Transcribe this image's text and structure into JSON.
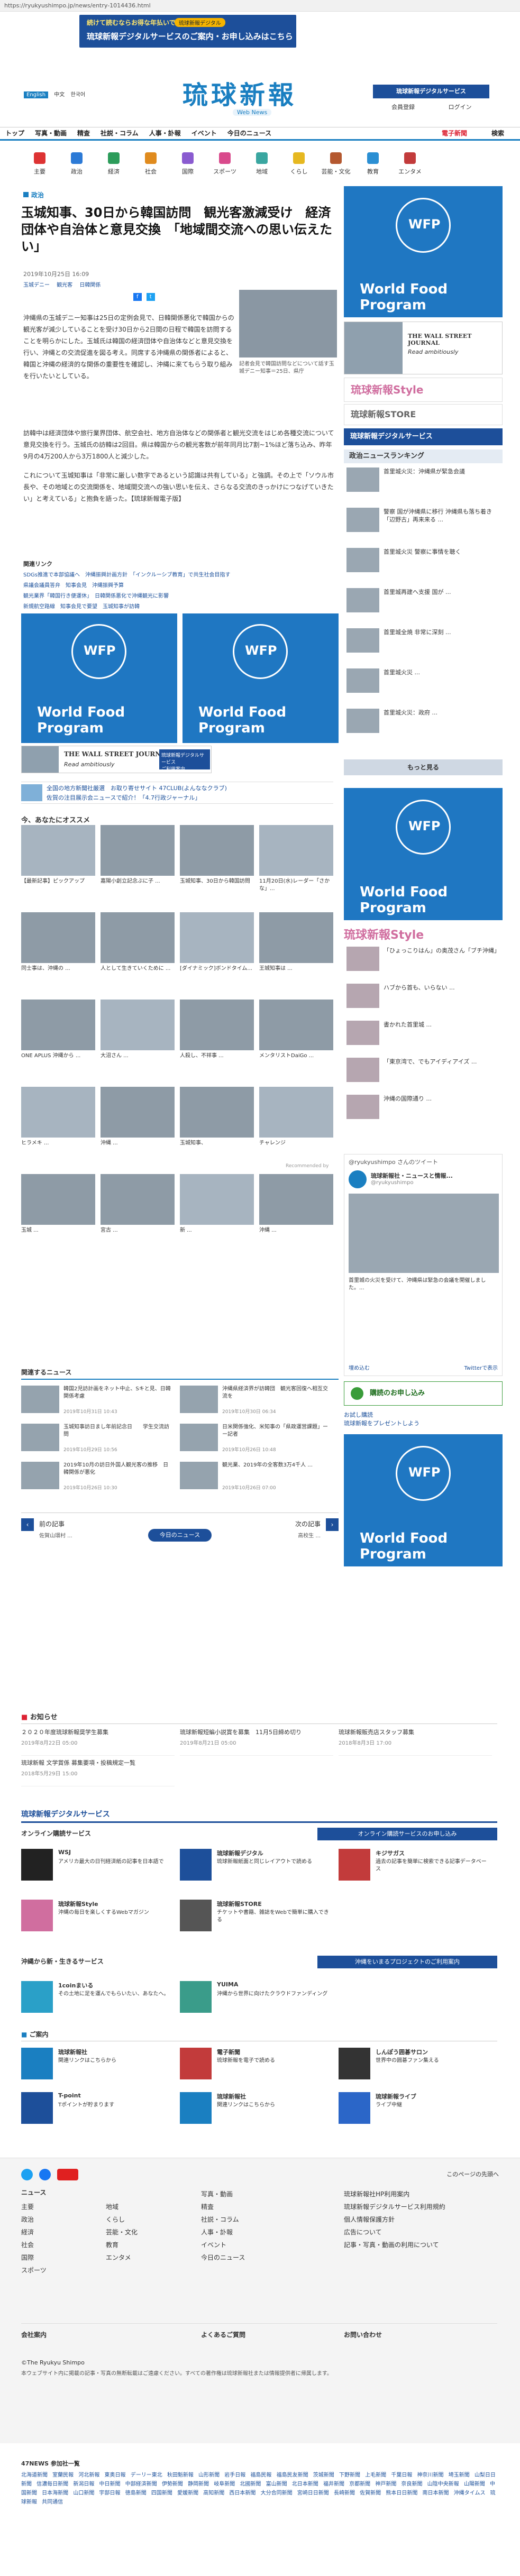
{
  "browser": {
    "url": "https://ryukyushimpo.jp/news/entry-1014436.html"
  },
  "top_banner": {
    "line1": "続けて読むならお得な年払いで",
    "pill": "琉球新報デジタル",
    "line2": "琉球新報デジタルサービスのご案内・お申し込みはこちら"
  },
  "header": {
    "logo": "琉球新報",
    "logo_sub": "Web News",
    "lang": [
      "English",
      "中文",
      "한국어"
    ],
    "digital_btn": "琉球新報デジタルサービス",
    "register": "会員登録",
    "login": "ログイン",
    "subscribe": "購読申込み"
  },
  "nav": [
    "トップ",
    "写真・動画",
    "精査",
    "社説・コラム",
    "人事・訃報",
    "イベント",
    "今日のニュース"
  ],
  "nav_right": {
    "shop": "電子新聞",
    "search": "検索"
  },
  "categories": [
    "主要",
    "政治",
    "経済",
    "社会",
    "国際",
    "スポーツ",
    "地域",
    "くらし",
    "芸能・文化",
    "教育",
    "エンタメ"
  ],
  "article": {
    "section": "政治",
    "title": "玉城知事、30日から韓国訪問　観光客激減受け　経済団体や自治体と意見交換　「地域間交流への思い伝えたい」",
    "meta": "2019年10月25日 16:09",
    "tags": [
      "玉城デニー",
      "観光客",
      "日韓関係"
    ],
    "caption": "記者会見で韓国訪問などについて話す玉城デニー知事＝25日、県庁",
    "p1": "沖縄県の玉城デニー知事は25日の定例会見で、日韓関係悪化で韓国からの観光客が減少していることを受け30日から2日間の日程で韓国を訪問することを明らかにした。玉城氏は韓国の経済団体や自治体などと意見交換を行い、沖縄との交流促進を図る考え。同席する沖縄県の関係者によると、韓国と沖縄の経済的な関係の重要性を確認し、沖縄に来てもらう取り組みを行いたいとしている。",
    "p2": "訪韓中は経済団体や旅行業界団体、航空会社、地方自治体などの関係者と観光交流をはじめ各種交流について意見交換を行う。玉城氏の訪韓は2回目。県は韓国からの観光客数が前年同月比7割~1%ほど落ち込み、昨年9月の4万200人から3万1800人と減少した。",
    "p3": "これについて玉城知事は「非常に厳しい数字であるという認識は共有している」と強調。その上で「ソウル市長や、その地域との交流関係を、地域間交流への強い思いを伝え、さらなる交流のきっかけにつなげていきたい」と考えている」と抱負を語った。【琉球新報電子版】"
  },
  "related_links_title": "関連リンク",
  "related_links": [
    "SDGs推進で本部協議へ　沖縄振興計画方針",
    "「インクルーシブ教育」で共生社会目指す",
    "県議会議員答弁",
    "知事会見",
    "沖縄振興予算",
    "観光業界「韓国行き便運休」",
    "日韓関係悪化で沖縄観光に影響",
    "新規航空路線",
    "知事会見で要望",
    "玉城知事が訪韓"
  ],
  "ads": {
    "wfp_name": "World Food Program",
    "wfp_short": "WFP",
    "wsj_line1": "THE WALL STREET JOURNAL",
    "wsj_line2": "Read ambitiously",
    "wsj_tag": "琉球新報デジタルサービス",
    "wsj_tag2": "ご利用案内"
  },
  "promo_link": "全国の地方新聞社厳選　お取り寄せサイト 47CLUB(よんななクラブ)",
  "promo_link2": "佐賀の注目展示会ニュースで紹介！「4.7行政ジャーナル」",
  "recommend_title": "今、あなたにオススメ",
  "recommend_items": [
    "【最新記事】ピックアップ",
    "嘉陽小創立記念ぶに子 ...",
    "玉城知事、30日から韓国訪問",
    "11月20日(水)レーダー「さかな」...",
    "同士事は、沖縄の ...",
    "人として生きていくために ...",
    "[ダイナミック]ボンドタイム...",
    "王城知事は ...",
    "ONE APLUS 沖縄から ...",
    "大沼さん ...",
    "人殺し、不祥事 ...",
    "メンタリストDaiGo ...",
    "ヒラメキ ...",
    "沖縄 ...",
    "玉城知事、",
    "チャレンジ",
    "玉城 ...",
    "宮古 ...",
    "新 ...",
    "沖縄 ..."
  ],
  "recommended_by": "Recommended by",
  "related_news_title": "関連するニュース",
  "related_news": [
    {
      "t": "韓国2児訪計画をネット中止、Sキと見、日韓関係考慮",
      "d": "2019年10月31日 10:43"
    },
    {
      "t": "沖縄県経済界が訪韓団　観光客回復へ相互交流を",
      "d": "2019年10月30日 06:34"
    },
    {
      "t": "玉城知事訪日まし年前記念日　　学生交流訪問",
      "d": "2019年10月29日 10:56"
    },
    {
      "t": "日米関係強化、米知事の「県政運営課題」ーー記者",
      "d": "2019年10月26日 10:48"
    },
    {
      "t": "2019年10月の訪日外国人観光客の推移　日韓関係が悪化",
      "d": "2019年10月26日 10:30"
    },
    {
      "t": "観光業、2019年の全客数3万4千人 ...",
      "d": "2019年10月26日 07:00"
    }
  ],
  "pager": {
    "prev": "前の記事",
    "next": "次の記事",
    "today": "今日のニュース",
    "prev_title": "佐賀山環村 ...",
    "next_title": "高校生 ..."
  },
  "right": {
    "wsj_tag": "琉球新報Style",
    "store": "琉球新報STORE",
    "digital_head": "琉球新報デジタルサービス",
    "ranking_title": "政治ニュースランキング",
    "ranking": [
      "首里城火災：沖縄県が緊急会議",
      "警察 国が沖縄県に移行 沖縄県も落ち着き 「辺野古」再来来る ...",
      "首里城火災 警察に事情を聴く",
      "首里城再建へ支援 国が ...",
      "首里城全焼 非常に深刻 ...",
      "首里城火災 ...",
      "首里城火災：政府 ..."
    ],
    "more": "もっと見る",
    "style_title": "琉球新報Style",
    "style_items": [
      "「ひょっこりはん」の奥茂さん「ブチ沖縄」",
      "ハブから首も、いらない ...",
      "書かれた首里城 ...",
      "「東京湾で、でもアイディアイズ ...",
      "沖縄の国際通り ..."
    ],
    "twitter_head": "@ryukyushimpo さんのツイート",
    "twitter_name": "琉球新報社・ニュースと情報...",
    "twitter_user": "@ryukyushimpo",
    "twitter_text": "首里城の火災を受けて、沖縄県は緊急の会議を開催しました。...",
    "twitter_embed": "埋め込む",
    "twitter_view": "Twitterで表示",
    "subscribe_box": "購読のお申し込み",
    "present_text": "お試し購読",
    "present_text2": "琉球新報をプレゼントしよう"
  },
  "notices_title": "お知らせ",
  "notices": [
    {
      "t": "２０２０年度琉球新報奨学生募集",
      "d": "2019年8月22日 05:00"
    },
    {
      "t": "琉球新報短編小説賞を募集　11月5日締め切り",
      "d": "2019年8月21日 05:00"
    },
    {
      "t": "琉球新報販売店スタッフ募集",
      "d": "2018年8月3日 17:00"
    },
    {
      "t": "琉球新報 文学賞係 募集要項・投稿規定一覧",
      "d": "2018年5月29日 15:00"
    }
  ],
  "digital": {
    "title": "琉球新報デジタルサービス",
    "online": "オンライン購読サービス",
    "online_btn": "オンライン購読サービスのお申し込み",
    "items": [
      {
        "n": "WSJ",
        "d": "アメリカ最大の日刊経済紙の記事を日本語で"
      },
      {
        "n": "琉球新報デジタル",
        "d": "琉球新報紙面と同じレイアウトで読める"
      },
      {
        "n": "キジサガス",
        "d": "過去の記事を簡単に検索できる記事データベース"
      },
      {
        "n": "琉球新報Style",
        "d": "沖縄の毎日を楽しくするWebマガジン"
      },
      {
        "n": "琉球新報STORE",
        "d": "チケットや書籍、雑誌をWebで簡単に購入できる"
      }
    ],
    "okinawa": "沖縄から新・生きるサービス",
    "okinawa_btn": "沖縄をいまるプロジェクトのご利用案内",
    "ok_items": [
      {
        "n": "1coinまいる",
        "d": "その土地に足を運んでもらいたい、あなたへ。"
      },
      {
        "n": "YUIMA",
        "d": "沖縄から世界に向けたクラウドファンディング"
      }
    ],
    "apps": "ご案内",
    "app_items": [
      {
        "n": "琉球新報社",
        "d": "関連リンクはこちらから"
      },
      {
        "n": "電子新聞",
        "d": "琉球新報を電子で読める"
      },
      {
        "n": "しんぽう囲碁サロン",
        "d": "世界中の囲碁ファン集える"
      },
      {
        "n": "T-point",
        "d": "Tポイントが貯まります"
      },
      {
        "n": "琉球新報社",
        "d": "関連リンクはこちらから"
      },
      {
        "n": "琉球新報ライブ",
        "d": "ライブ中継"
      }
    ]
  },
  "footer": {
    "top_right": "このページの先頭へ",
    "news_head": "ニュース",
    "col1": [
      "主要",
      "政治",
      "経済",
      "社会",
      "国際",
      "スポーツ"
    ],
    "col2": [
      "地域",
      "くらし",
      "芸能・文化",
      "教育",
      "エンタメ"
    ],
    "col3": [
      "写真・動画",
      "精査",
      "社説・コラム",
      "人事・訃報",
      "イベント",
      "今日のニュース"
    ],
    "col4": [
      "琉球新報社HP利用案内",
      "琉球新報デジタルサービス利用規約",
      "個人情報保護方針",
      "広告について",
      "記事・写真・動画の利用について"
    ],
    "bottom": [
      "会社案内",
      "よくあるご質問",
      "お問い合わせ"
    ],
    "copyright": "©The Ryukyu Shimpo",
    "note": "本ウェブサイト内に掲載の記事・写真の無断転載はご遠慮ください。すべての著作権は琉球新報社または情報提供者に帰属します。",
    "net47": "47NEWS 参加社一覧",
    "papers": "北海道新聞 室蘭民報 河北新報 東奥日報 デーリー東北 秋田魁新報 山形新聞 岩手日報 福島民報 福島民友新聞 茨城新聞 下野新聞 上毛新聞 千葉日報 神奈川新聞 埼玉新聞 山梨日日新聞 信濃毎日新聞 新潟日報 中日新聞 中部経済新聞 伊勢新聞 静岡新聞 岐阜新聞 北國新聞 富山新聞 北日本新聞 福井新聞 京都新聞 神戸新聞 奈良新聞 山陰中央新報 山陽新聞 中国新聞 日本海新聞 山口新聞 宇部日報 徳島新聞 四国新聞 愛媛新聞 高知新聞 西日本新聞 大分合同新聞 宮崎日日新聞 長崎新聞 佐賀新聞 熊本日日新聞 南日本新聞 沖縄タイムス 琉球新報 共同通信"
  }
}
